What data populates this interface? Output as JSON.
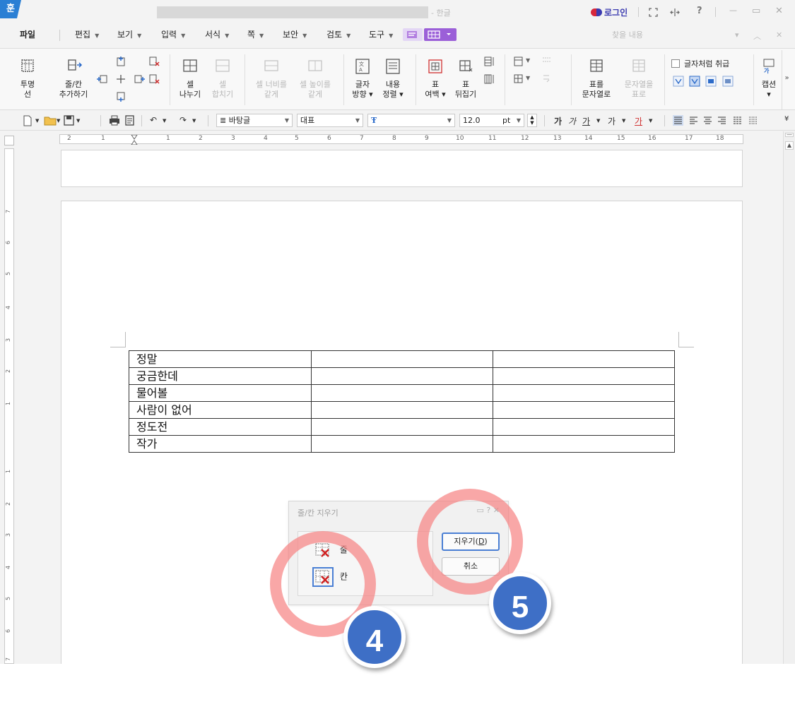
{
  "titlebar": {
    "app_logo": "훈",
    "title_suffix": "- 한글",
    "login_label": "로그인",
    "icons": [
      "fullscreen-icon",
      "resize-icon",
      "help-icon",
      "minimize-icon",
      "restore-icon",
      "close-icon"
    ],
    "help_glyph": "?",
    "minimize_glyph": "—",
    "restore_glyph": "▭",
    "close_glyph": "✕"
  },
  "menubar": {
    "items": [
      "파일",
      "편집",
      "보기",
      "입력",
      "서식",
      "쪽",
      "보안",
      "검토",
      "도구"
    ],
    "search_placeholder": "찾을 내용"
  },
  "ribbon": {
    "buttons": [
      {
        "label1": "투명",
        "label2": "선",
        "enabled": true
      },
      {
        "label1": "줄/칸",
        "label2": "추가하기",
        "enabled": true
      },
      {
        "label1": "셀",
        "label2": "나누기",
        "enabled": true
      },
      {
        "label1": "셀",
        "label2": "합치기",
        "enabled": false
      },
      {
        "label1": "셀 너비를",
        "label2": "같게",
        "enabled": false
      },
      {
        "label1": "셀 높이를",
        "label2": "같게",
        "enabled": false
      },
      {
        "label1": "글자",
        "label2": "방향 ▾",
        "enabled": true
      },
      {
        "label1": "내용",
        "label2": "정렬 ▾",
        "enabled": true
      },
      {
        "label1": "표",
        "label2": "여백 ▾",
        "enabled": true
      },
      {
        "label1": "표",
        "label2": "뒤집기",
        "enabled": true
      },
      {
        "label1": "표를",
        "label2": "문자열로",
        "enabled": true
      },
      {
        "label1": "문자열을",
        "label2": "표로",
        "enabled": false
      },
      {
        "label1": "캡션",
        "label2": "▾",
        "enabled": true
      }
    ],
    "checkbox_label": "글자처럼 취급",
    "checkbox_checked": false
  },
  "format_toolbar": {
    "style": "바탕글",
    "font": "대표",
    "font_face": "",
    "font_size": "12.0",
    "unit": "pt"
  },
  "ruler": {
    "h_marks": [
      "2",
      "1",
      "1",
      "2",
      "3",
      "4",
      "5",
      "6",
      "7",
      "8",
      "9",
      "10",
      "11",
      "12",
      "13",
      "14",
      "15",
      "16",
      "17",
      "18"
    ],
    "v_marks": [
      "7",
      "6",
      "5",
      "4",
      "3",
      "2",
      "1",
      "1",
      "2",
      "3",
      "4",
      "5",
      "6",
      "7"
    ]
  },
  "table": {
    "rows": [
      [
        "정말",
        "",
        ""
      ],
      [
        "궁금한데",
        "",
        ""
      ],
      [
        "물어볼",
        "",
        ""
      ],
      [
        "사람이 없어",
        "",
        ""
      ],
      [
        "정도전",
        "",
        ""
      ],
      [
        "작가",
        "",
        ""
      ]
    ]
  },
  "dialog": {
    "title": "줄/칸 지우기",
    "title_icons": "▭ ? ✕",
    "option_row": "줄",
    "option_col": "칸",
    "selected": "칸",
    "delete_button_prefix": "지우기(",
    "delete_button_key": "D",
    "delete_button_suffix": ")",
    "cancel_button": "취소"
  },
  "annotations": {
    "step_a": "4",
    "step_b": "5",
    "ring_color": "#f68282",
    "badge_color": "#3e6fc6"
  }
}
